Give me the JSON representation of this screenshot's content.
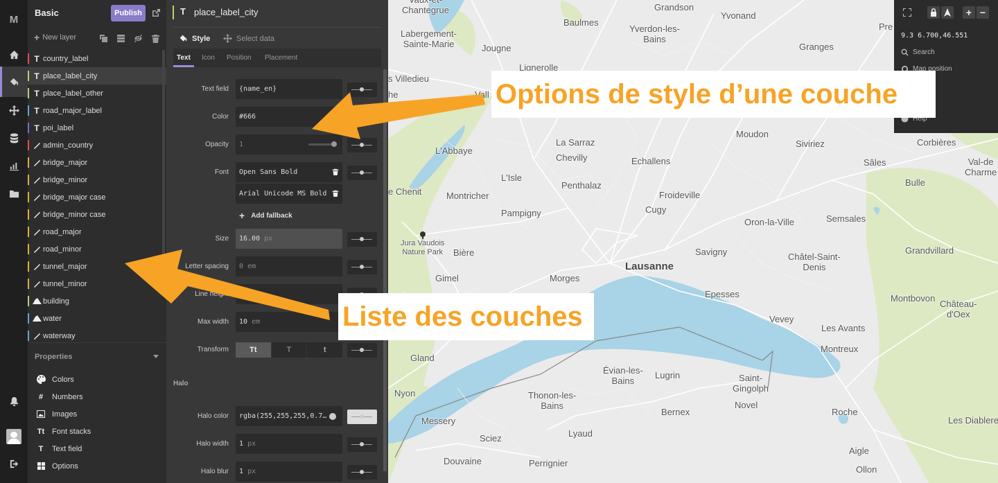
{
  "app": {
    "logo": "M",
    "project_title": "Basic",
    "publish_label": "Publish"
  },
  "layers_panel": {
    "new_layer_label": "New layer",
    "layers": [
      {
        "name": "country_label",
        "type": "T",
        "color": "#e05050"
      },
      {
        "name": "place_label_city",
        "type": "T",
        "color": "#b9d66a",
        "selected": true
      },
      {
        "name": "place_label_other",
        "type": "T",
        "color": "#b9d66a"
      },
      {
        "name": "road_major_label",
        "type": "T",
        "color": "#5aa9d6"
      },
      {
        "name": "poi_label",
        "type": "T",
        "color": "#7a6cd0"
      },
      {
        "name": "admin_country",
        "type": "line",
        "color": "#e05050"
      },
      {
        "name": "bridge_major",
        "type": "line",
        "color": "#e0b040"
      },
      {
        "name": "bridge_minor",
        "type": "line",
        "color": "#e0b040"
      },
      {
        "name": "bridge_major case",
        "type": "line",
        "color": "#e0b040"
      },
      {
        "name": "bridge_minor case",
        "type": "line",
        "color": "#e0b040"
      },
      {
        "name": "road_major",
        "type": "line",
        "color": "#e0b040"
      },
      {
        "name": "road_minor",
        "type": "line",
        "color": "#e0b040"
      },
      {
        "name": "tunnel_major",
        "type": "line",
        "color": "#e0b040"
      },
      {
        "name": "tunnel_minor",
        "type": "line",
        "color": "#e0b040"
      },
      {
        "name": "building",
        "type": "fill",
        "color": "#b9d66a"
      },
      {
        "name": "water",
        "type": "fill",
        "color": "#5aa9d6"
      },
      {
        "name": "waterway",
        "type": "line",
        "color": "#5aa9d6"
      }
    ],
    "properties_heading": "Properties",
    "properties": [
      {
        "label": "Colors",
        "icon": "palette-icon"
      },
      {
        "label": "Numbers",
        "icon": "hash-icon"
      },
      {
        "label": "Images",
        "icon": "image-icon"
      },
      {
        "label": "Font stacks",
        "icon": "font-icon"
      },
      {
        "label": "Text field",
        "icon": "text-field-icon"
      },
      {
        "label": "Options",
        "icon": "grid-icon"
      }
    ]
  },
  "style_panel": {
    "layer_type": "T",
    "layer_name": "place_label_city",
    "tabs": [
      "Style",
      "Select data"
    ],
    "subtabs": [
      "Text",
      "Icon",
      "Position",
      "Placement"
    ],
    "fields": {
      "text_field": {
        "label": "Text field",
        "value": "{name_en}"
      },
      "color": {
        "label": "Color",
        "value": "#666"
      },
      "opacity": {
        "label": "Opacity",
        "value": "1"
      },
      "font": {
        "label": "Font",
        "value1": "Open Sans Bold",
        "value2": "Arial Unicode MS Bold"
      },
      "add_fallback": "Add fallback",
      "size": {
        "label": "Size",
        "value": "16.00",
        "unit": "px"
      },
      "letter_spacing": {
        "label": "Letter spacing",
        "value": "0",
        "unit": "em"
      },
      "line_height": {
        "label": "Line height"
      },
      "max_width": {
        "label": "Max width",
        "value": "10",
        "unit": "em"
      },
      "transform": {
        "label": "Transform",
        "options": [
          "Tt",
          "T",
          "t"
        ]
      }
    },
    "halo_heading": "Halo",
    "halo": {
      "color": {
        "label": "Halo color",
        "value": "rgba(255,255,255,0.7…"
      },
      "width": {
        "label": "Halo width",
        "value": "1",
        "unit": "px"
      },
      "blur": {
        "label": "Halo blur",
        "value": "1",
        "unit": "px"
      }
    }
  },
  "map_controls": {
    "coords": "9.3 6.700,46.551",
    "search": "Search",
    "map_position": "Map position",
    "help": "Help"
  },
  "annotations": {
    "style_options": "Options de style d’une couche",
    "layer_list": "Liste des couches"
  },
  "map_labels": {
    "vaux_et_chantegrue": "Vaux-et-\nChantegrue",
    "grandson": "Grandson",
    "yvonand": "Yvonand",
    "pre": "Pre",
    "labergement": "Labergement-\nSainte-Marie",
    "jougne": "Jougne",
    "baulmes": "Baulmes",
    "yverdon": "Yverdon-les-\nBains",
    "granges": "Granges",
    "lignerolle": "Lignerolle",
    "villedieu": "s Villedieu",
    "vallorbe": "Vall",
    "he": "he",
    "moudon": "Moudon",
    "corbieres": "Corbières",
    "labbaye": "L'Abbaye",
    "la_sarraz": "La Sarraz",
    "chevilly": "Chevilly",
    "siviriez": "Siviriez",
    "sales": "Sâles",
    "val_de_charme": "Val-de\nCharme",
    "echallens": "Echallens",
    "le_chenit": "e Chenit",
    "lisle": "L'Isle",
    "penthalaz": "Penthalaz",
    "froideville": "Froideville",
    "bulle": "Bulle",
    "montricher": "Montricher",
    "cugy": "Cugy",
    "pampigny": "Pampigny",
    "oron": "Oron-la-Ville",
    "semsales": "Semsales",
    "jura_park": "Jura Vaudois\nNature Park",
    "biere": "Bière",
    "lausanne": "Lausanne",
    "savigny": "Savigny",
    "chatel": "Châtel-Saint-\nDenis",
    "grandvillard": "Grandvillard",
    "gimel": "Gimel",
    "morges": "Morges",
    "epesses": "Epesses",
    "montbovon": "Montbovon",
    "chateau_doex": "Château-\nd'Oex",
    "vevey": "Vevey",
    "les_avants": "Les Avants",
    "gland": "Gland",
    "montreux": "Montreux",
    "evian": "Évian-les-\nBains",
    "lugrin": "Lugrin",
    "saint_gingolph": "Saint-\nGingolph",
    "nyon": "Nyon",
    "thonon": "Thonon-les-\nBains",
    "novel": "Novel",
    "bernex": "Bernex",
    "roche": "Roche",
    "messery": "Messery",
    "lyaud": "Lyaud",
    "les_diablerets": "Les Diablere",
    "sciez": "Sciez",
    "douvaine": "Douvaine",
    "perrignier": "Perrignier",
    "aigle": "Aigle",
    "ollon": "Ollon"
  }
}
